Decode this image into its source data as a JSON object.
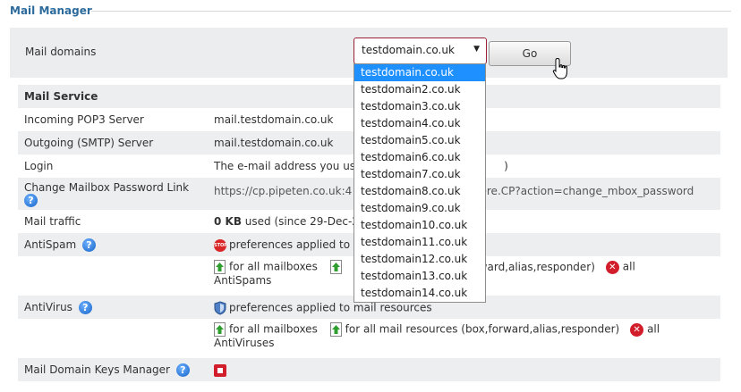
{
  "header": {
    "title": "Mail Manager"
  },
  "domain_select": {
    "label": "Mail domains",
    "value": "testdomain.co.uk",
    "go_label": "Go",
    "options": [
      "testdomain.co.uk",
      "testdomain2.co.uk",
      "testdomain3.co.uk",
      "testdomain4.co.uk",
      "testdomain5.co.uk",
      "testdomain6.co.uk",
      "testdomain7.co.uk",
      "testdomain8.co.uk",
      "testdomain9.co.uk",
      "testdomain10.co.uk",
      "testdomain11.co.uk",
      "testdomain12.co.uk",
      "testdomain13.co.uk",
      "testdomain14.co.uk"
    ]
  },
  "mail_service": {
    "heading": "Mail Service",
    "pop3_label": "Incoming POP3 Server",
    "pop3_value": "mail.testdomain.co.uk",
    "smtp_label": "Outgoing (SMTP) Server",
    "smtp_value": "mail.testdomain.co.uk",
    "login_label": "Login",
    "login_value": "The e-mail address you us",
    "login_tail": ")",
    "pwd_label": "Change Mailbox Password Link",
    "pwd_value_start": "https://cp.pipeten.co.uk:4",
    "pwd_value_end": "phere.CP?action=change_mbox_password",
    "traffic_label": "Mail traffic",
    "traffic_amount": "0 KB",
    "traffic_rest": " used (since 29-Dec-2",
    "antispam_label": "AntiSpam",
    "antispam_pref": "preferences applied to",
    "antispam_all_mailboxes": "for all mailboxes",
    "antispam_resources_tail": "t,forward,alias,responder)",
    "antispam_all": "all",
    "antispam_all2": "AntiSpams",
    "antivirus_label": "AntiVirus",
    "antivirus_pref": "preferences applied to mail resources",
    "antivirus_all_mailboxes": "for all mailboxes",
    "antivirus_resources": "for all mail resources (box,forward,alias,responder)",
    "antivirus_all": "all",
    "antivirus_all2": "AntiViruses",
    "dkim_label": "Mail Domain Keys Manager"
  },
  "icons": {
    "help": "?",
    "close": "✕",
    "stop": "STOP"
  },
  "colors": {
    "accent": "#2c6a9c",
    "selected": "#1e90ff",
    "danger": "#d21e2b"
  }
}
